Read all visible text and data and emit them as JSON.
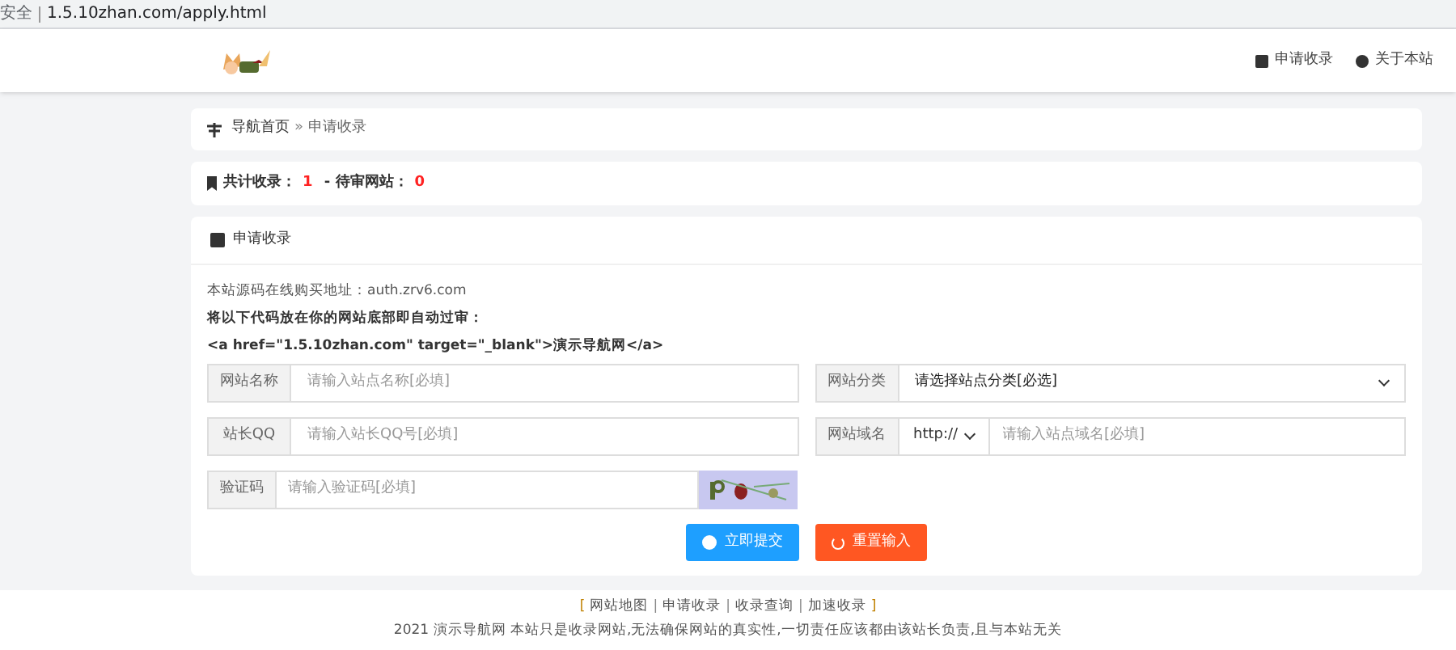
{
  "browser": {
    "security": "安全",
    "url": "1.5.10zhan.com/apply.html"
  },
  "nav": [
    {
      "label": "申请收录"
    },
    {
      "label": "关于本站"
    }
  ],
  "breadcrumb": {
    "home": "导航首页",
    "separator": "»",
    "current": "申请收录"
  },
  "stats": {
    "total_label": "共计收录：",
    "total": "1",
    "separator": " - ",
    "pending_label": "待审网站：",
    "pending": "0"
  },
  "form": {
    "title": "申请收录",
    "lines": [
      {
        "text": "本站源码在线购买地址：auth.zrv6.com",
        "bold": false
      },
      {
        "text": "将以下代码放在你的网站底部即自动过审：",
        "bold": true
      },
      {
        "text": "<a href=\"1.5.10zhan.com\" target=\"_blank\">演示导航网</a>",
        "bold": true
      }
    ],
    "fields": [
      {
        "kind": "text",
        "label": "网站名称",
        "placeholder": "请输入站点名称[必填]"
      },
      {
        "kind": "select",
        "label": "网站分类",
        "value": "请选择站点分类[必选]"
      },
      {
        "kind": "text",
        "label": "站长QQ",
        "placeholder": "请输入站长QQ号[必填]"
      },
      {
        "kind": "url",
        "label": "网站域名",
        "protocol": "http://",
        "placeholder": "请输入站点域名[必填]"
      },
      {
        "kind": "captcha",
        "label": "验证码",
        "placeholder": "请输入验证码[必填]"
      }
    ],
    "buttons": [
      {
        "kind": "submit",
        "label": "立即提交"
      },
      {
        "kind": "reset",
        "label": "重置输入"
      }
    ]
  },
  "footer": {
    "open": "[",
    "close": "]",
    "divider": "|",
    "links": [
      "网站地图",
      "申请收录",
      "收录查询",
      "加速收录"
    ],
    "notice": "2021 演示导航网 本站只是收录网站,无法确保网站的真实性,一切责任应该都由该站长负责,且与本站无关"
  }
}
